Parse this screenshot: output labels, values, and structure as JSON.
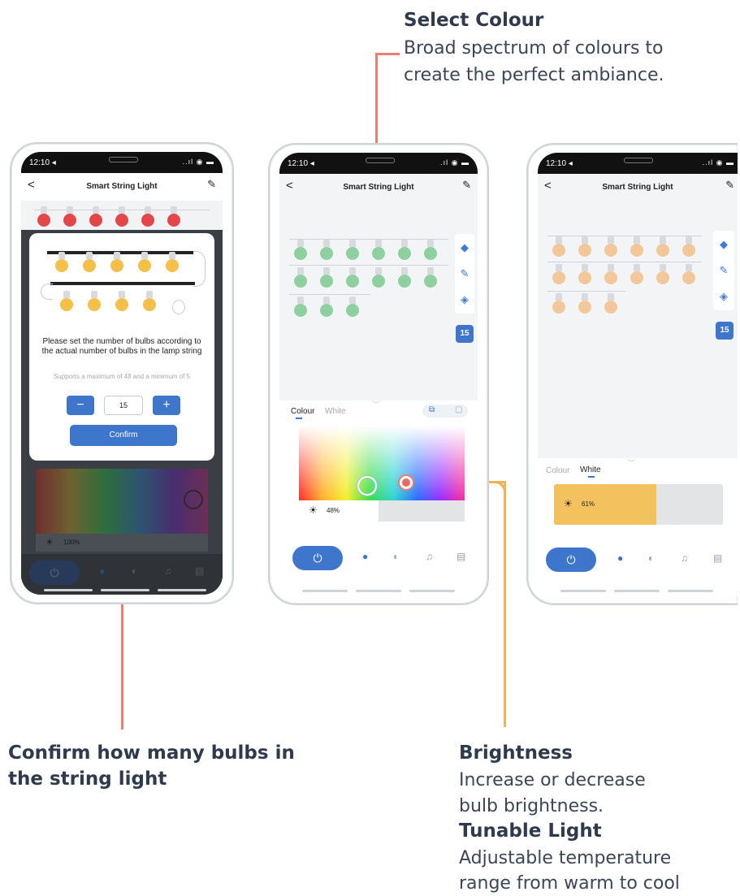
{
  "captions": {
    "select_colour_title": "Select Colour",
    "select_colour_line1": "Broad spectrum of colours to",
    "select_colour_line2": "create the perfect ambiance.",
    "confirm_line1": "Confirm how many bulbs in",
    "confirm_line2": "the string light",
    "brightness_title": "Brightness",
    "brightness_line1": "Increase or decrease",
    "brightness_line2": "bulb brightness.",
    "tunable_title": "Tunable Light",
    "tunable_line1": "Adjustable temperature",
    "tunable_line2": "range from warm to cool"
  },
  "status": {
    "time": "12:10 ◂",
    "signal": "..ıl ◉ ▬"
  },
  "app": {
    "back": "<",
    "title": "Smart String Light",
    "edit": "✎"
  },
  "popup": {
    "message": "Please set the number of bulbs according to the actual number of bulbs in the lamp string",
    "support": "Supports a maximum of 48 and a minimum of 5",
    "minus": "−",
    "plus": "+",
    "count": "15",
    "confirm": "Confirm"
  },
  "phone1": {
    "brightness": "100%"
  },
  "phone2": {
    "tab_colour": "Colour",
    "tab_white": "White",
    "brightness": "48%",
    "bulb_count": "15"
  },
  "phone3": {
    "tab_colour": "Colour",
    "tab_white": "White",
    "brightness": "61%",
    "bulb_count": "15"
  },
  "nav": {
    "power": "⏻",
    "bulb": "●",
    "palette": "◐",
    "music": "♫",
    "schedule": "▤"
  },
  "tools": {
    "paint": "◆",
    "brush": "✎",
    "eraser": "◈"
  },
  "colors": {
    "accent": "#3e76cc",
    "red_bulb": "#e4474a",
    "yellow_bulb": "#f5c04a",
    "green_bulb": "#8fd0a0",
    "warm_bulb": "#f2c89a",
    "warm_bar": "#f4c15f"
  }
}
